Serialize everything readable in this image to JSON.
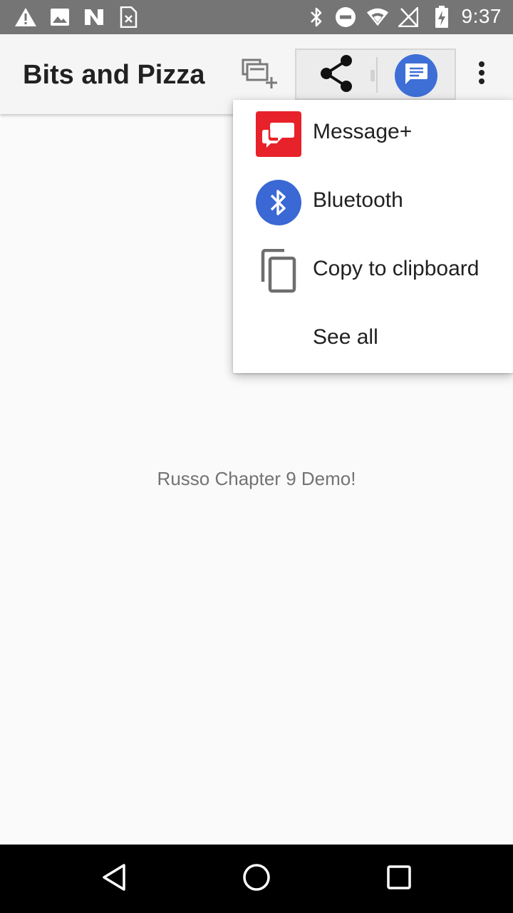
{
  "status_bar": {
    "time": "9:37",
    "icons": [
      "warning-icon",
      "image-icon",
      "n-logo-icon",
      "sim-icon",
      "bluetooth-icon",
      "do-not-disturb-icon",
      "wifi-icon",
      "no-signal-icon",
      "battery-charging-icon"
    ],
    "background": "#757575"
  },
  "app_bar": {
    "title": "Bits and Pizza",
    "actions": [
      "cast-icon",
      "share-icon",
      "messages-app-icon",
      "overflow-menu-icon"
    ]
  },
  "share_menu": {
    "items": [
      {
        "label": "Message+",
        "icon": "message-plus-icon",
        "color": "#e8222a"
      },
      {
        "label": "Bluetooth",
        "icon": "bluetooth-icon",
        "color": "#3a68d4"
      },
      {
        "label": "Copy to clipboard",
        "icon": "copy-icon"
      },
      {
        "label": "See all"
      }
    ]
  },
  "content": {
    "text": "Russo Chapter 9 Demo!"
  },
  "nav_bar": {
    "buttons": [
      "back-icon",
      "home-icon",
      "recents-icon"
    ]
  }
}
